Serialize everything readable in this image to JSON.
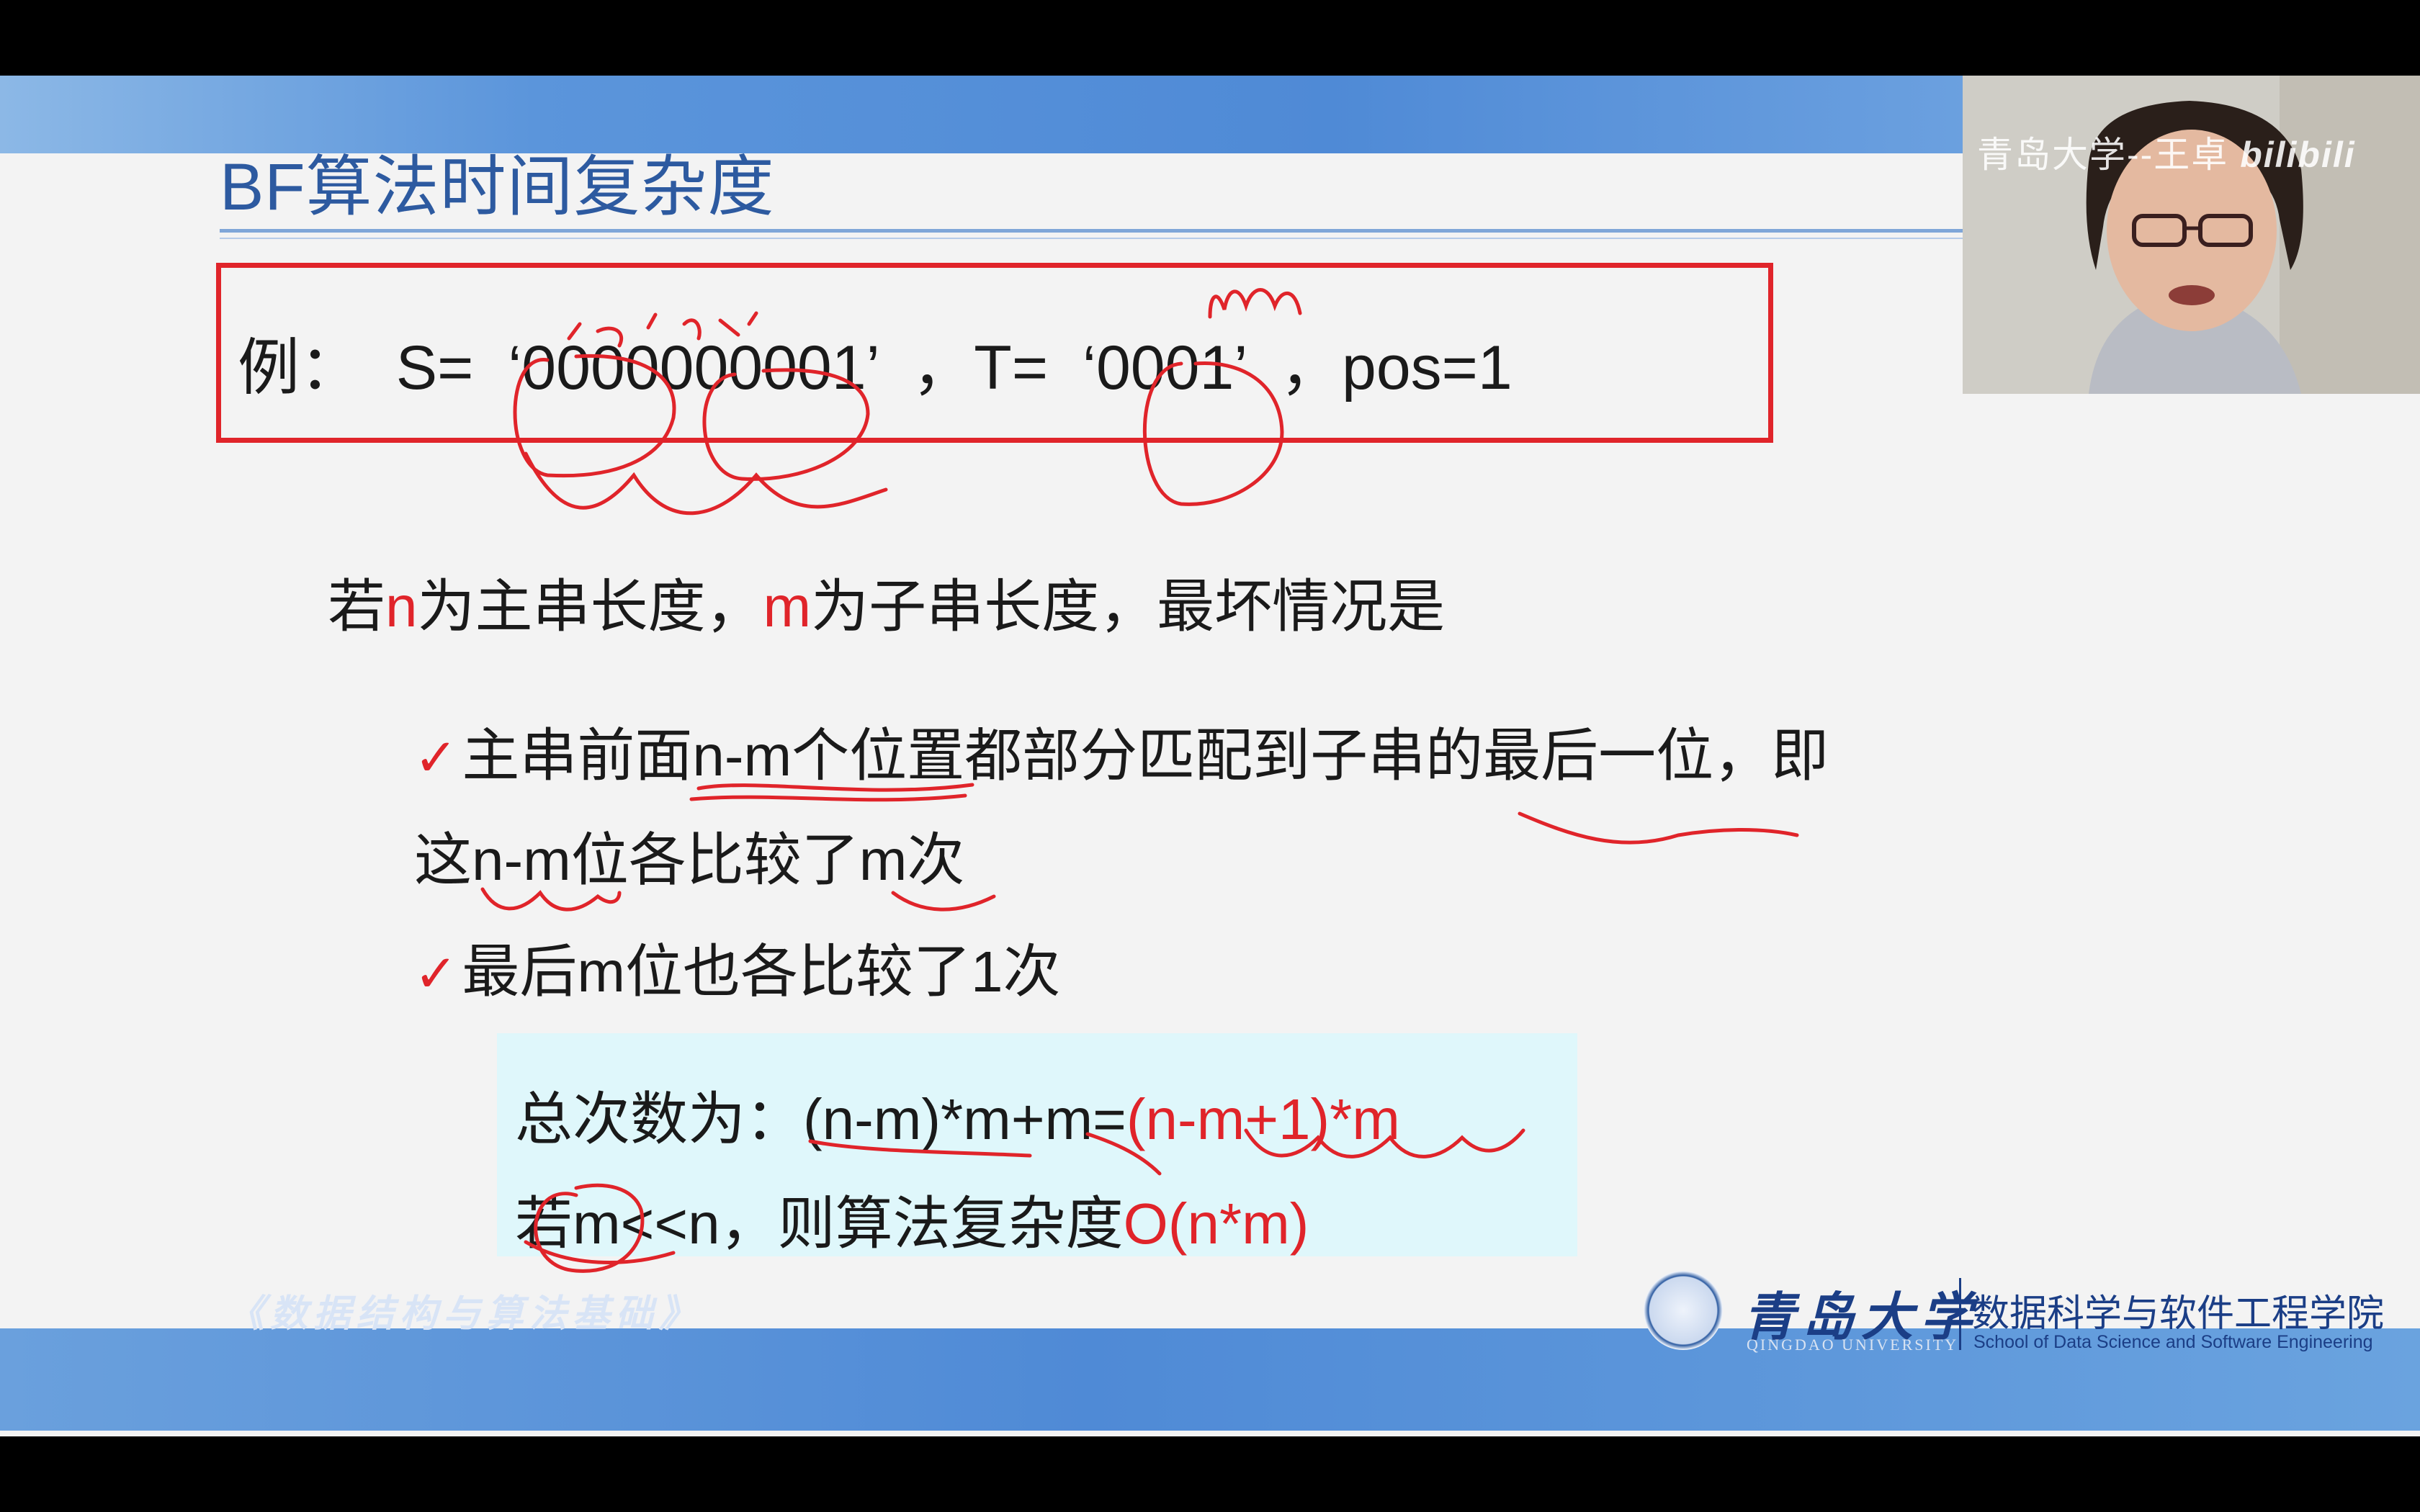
{
  "slide": {
    "title": "BF算法时间复杂度",
    "example": {
      "prefix": "例：",
      "s_label": "S=",
      "s_value": "‘0000000001’",
      "sep": "，",
      "t_label": "T=",
      "t_value": "‘0001’",
      "pos": "pos=1"
    },
    "intro": {
      "p1": "若",
      "n": "n",
      "p2": "为主串长度，",
      "m": "m",
      "p3": "为子串长度，最坏情况是"
    },
    "bullet1_line1": "主串前面n-m个位置都部分匹配到子串的最后一位，即",
    "bullet1_line2": "这n-m位各比较了m次",
    "bullet2": "最后m位也各比较了1次",
    "check_mark": "✓",
    "formula1_black": "总次数为：(n-m)*m+m=",
    "formula1_red": "(n-m+1)*m",
    "formula2_black": "若m<<n，则算法复杂度",
    "formula2_red": "O(n*m)",
    "annotation_m": "m",
    "annotation_small": "(2)(3)"
  },
  "footer": {
    "course_title": "《数据结构与算法基础》",
    "university_cn": "青岛大学",
    "university_en": "QINGDAO UNIVERSITY",
    "school_cn": "数据科学与软件工程学院",
    "school_en": "School of Data Science and Software Engineering"
  },
  "webcam": {
    "watermark": "青岛大学--王卓",
    "brand": "bilibili"
  },
  "colors": {
    "accent_red": "#e0242a",
    "title_blue": "#2d5aa0",
    "band_blue": "#4f8ad6",
    "formula_bg": "#dff7fb"
  }
}
